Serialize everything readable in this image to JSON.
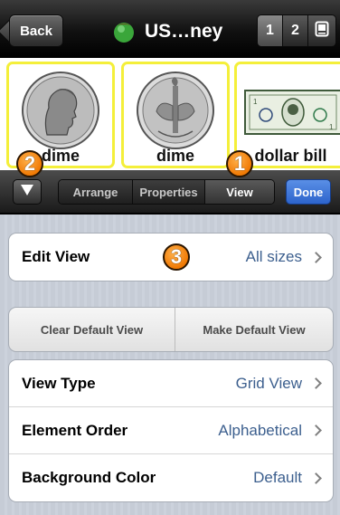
{
  "nav": {
    "back_label": "Back",
    "title": "US…ney",
    "segments": [
      "1",
      "2"
    ],
    "tablet_icon": "tablet-icon",
    "app_icon": "green-ball-icon"
  },
  "strip": {
    "items": [
      {
        "label": "dime",
        "image": "dime-front-image"
      },
      {
        "label": "dime",
        "image": "dime-back-image"
      },
      {
        "label": "dollar bill",
        "image": "dollar-bill-image"
      }
    ]
  },
  "toolbar": {
    "collapse_icon": "down-triangle-icon",
    "tabs": [
      "Arrange",
      "Properties",
      "View"
    ],
    "active_tab": "View",
    "done_label": "Done"
  },
  "callouts": [
    "2",
    "1",
    "3"
  ],
  "settings": {
    "edit_view": {
      "label": "Edit View",
      "value": "All sizes"
    },
    "clear_default": "Clear Default View",
    "make_default": "Make Default View",
    "rows": [
      {
        "label": "View Type",
        "value": "Grid View"
      },
      {
        "label": "Element Order",
        "value": "Alphabetical"
      },
      {
        "label": "Background Color",
        "value": "Default"
      }
    ]
  },
  "colors": {
    "accent_done": "#2d64cc",
    "tile_border": "#f4ef3a",
    "value_text": "#3c5f8e",
    "callout": "#f07a05"
  }
}
